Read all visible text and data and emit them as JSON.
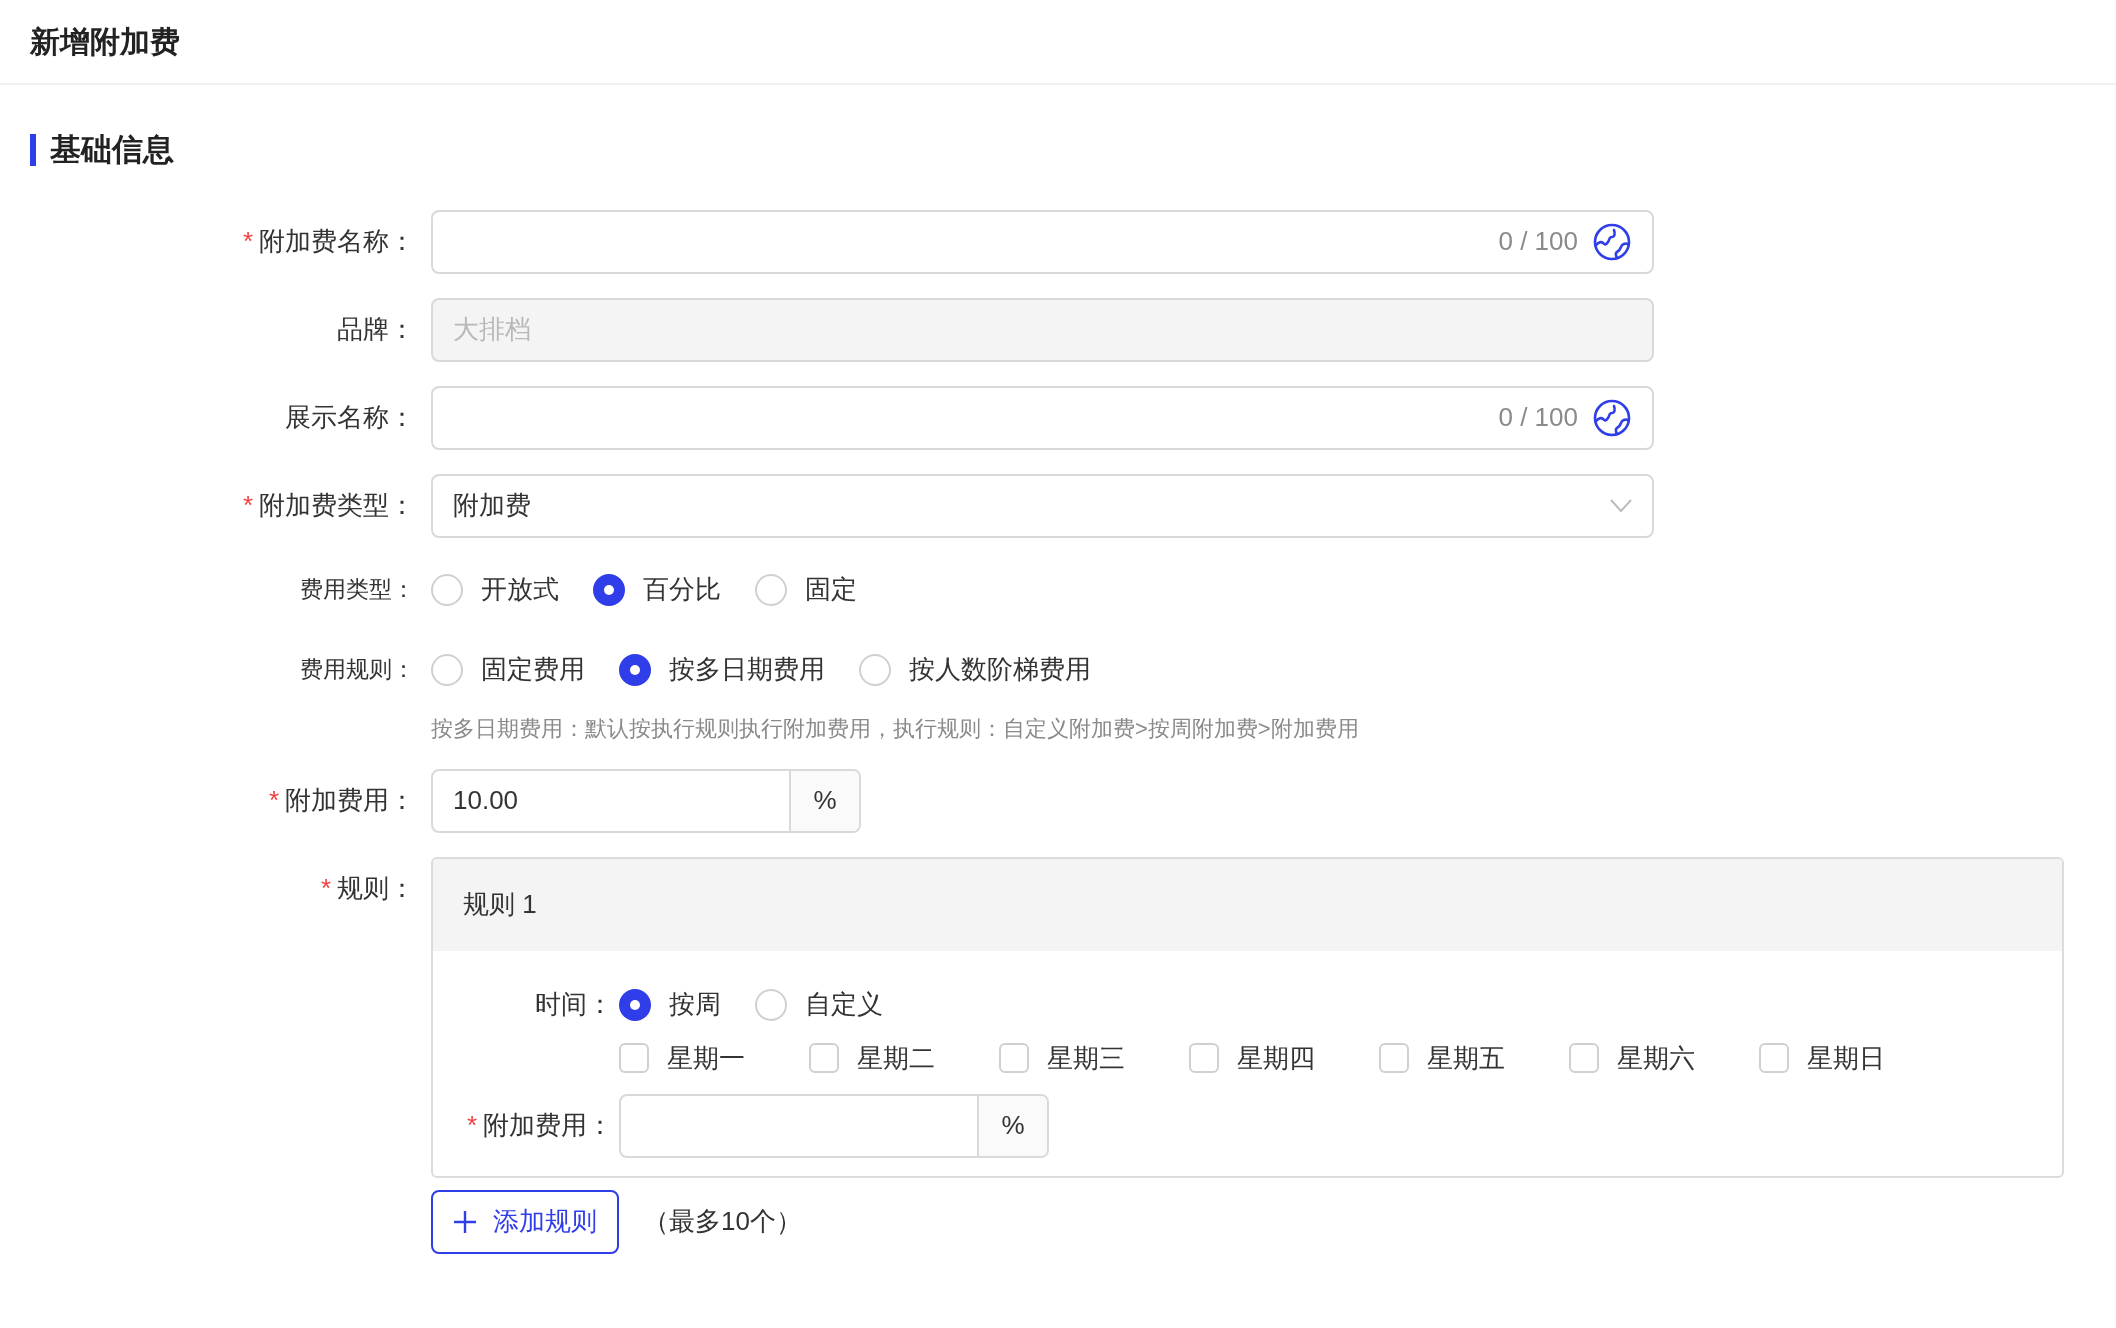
{
  "header": {
    "title": "新增附加费"
  },
  "section": {
    "title": "基础信息"
  },
  "fields": [
    {
      "kind": "text",
      "label": "附加费名称：",
      "required_mark": "*",
      "counter": "0 / 100"
    },
    {
      "kind": "text",
      "label": "品牌：",
      "disabled": true,
      "placeholder": "大排档"
    },
    {
      "kind": "text",
      "label": "展示名称：",
      "counter": "0 / 100"
    },
    {
      "kind": "select",
      "label": "附加费类型：",
      "required_mark": "*",
      "value": "附加费"
    },
    {
      "kind": "radio",
      "label": "费用类型：",
      "options": [
        {
          "label": "开放式",
          "selected": false
        },
        {
          "label": "百分比",
          "selected": true
        },
        {
          "label": "固定",
          "selected": false
        }
      ]
    },
    {
      "kind": "radio",
      "label": "费用规则：",
      "options": [
        {
          "label": "固定费用",
          "selected": false
        },
        {
          "label": "按多日期费用",
          "selected": true
        },
        {
          "label": "按人数阶梯费用",
          "selected": false
        }
      ],
      "help": "按多日期费用：默认按执行规则执行附加费用，执行规则：自定义附加费>按周附加费>附加费用"
    },
    {
      "kind": "addon",
      "label": "附加费用：",
      "required_mark": "*",
      "value": "10.00",
      "suffix": "%"
    },
    {
      "kind": "rules",
      "label": "规则：",
      "required_mark": "*",
      "rules": [
        {
          "title": "规则 1",
          "time_label": "时间：",
          "time_options": [
            {
              "label": "按周",
              "selected": true
            },
            {
              "label": "自定义",
              "selected": false
            }
          ],
          "weekdays": [
            {
              "label": "星期一",
              "checked": false
            },
            {
              "label": "星期二",
              "checked": false
            },
            {
              "label": "星期三",
              "checked": false
            },
            {
              "label": "星期四",
              "checked": false
            },
            {
              "label": "星期五",
              "checked": false
            },
            {
              "label": "星期六",
              "checked": false
            },
            {
              "label": "星期日",
              "checked": false
            }
          ],
          "fee": {
            "label": "附加费用：",
            "required_mark": "*",
            "suffix": "%"
          }
        }
      ],
      "add_button": "添加规则",
      "limit_note": "（最多10个）"
    }
  ]
}
